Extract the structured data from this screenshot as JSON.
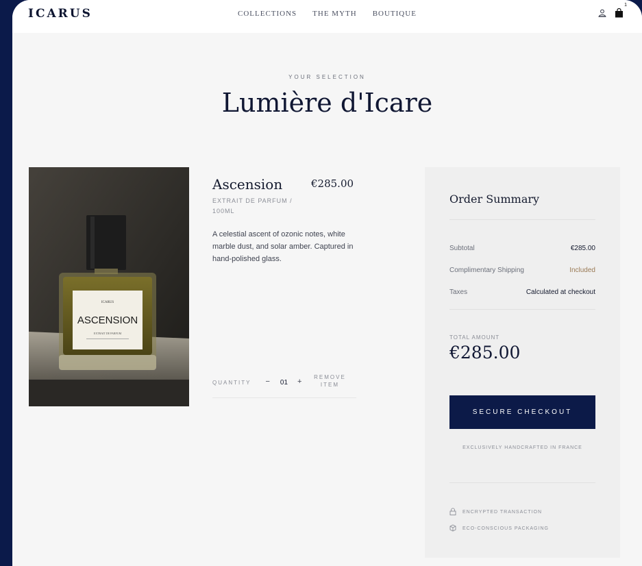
{
  "header": {
    "brand": "ICARUS",
    "nav": [
      {
        "label": "COLLECTIONS"
      },
      {
        "label": "THE MYTH"
      },
      {
        "label": "BOUTIQUE"
      }
    ],
    "icons": {
      "account": "user-icon",
      "cart": "shopping-bag-icon"
    },
    "cart_count": "1"
  },
  "hero": {
    "eyebrow": "YOUR SELECTION",
    "title": "Lumière d'Icare"
  },
  "product_image": {
    "label_brand": "ICARUS",
    "label_name": "ASCENSION",
    "label_sub": "EXTRAIT DE PARFUM"
  },
  "item": {
    "name": "Ascension",
    "price": "€285.00",
    "variant": "EXTRAIT DE PARFUM / 100ML",
    "description": "A celestial ascent of ozonic notes, white marble dust, and solar amber. Captured in hand-polished glass.",
    "quantity_label": "QUANTITY",
    "minus": "−",
    "quantity": "01",
    "plus": "+",
    "remove": "REMOVE ITEM"
  },
  "summary": {
    "title": "Order Summary",
    "rows": [
      {
        "label": "Subtotal",
        "value": "€285.00"
      },
      {
        "label": "Complimentary Shipping",
        "value": "Included"
      },
      {
        "label": "Taxes",
        "value": "Calculated at checkout"
      }
    ],
    "total_label": "TOTAL AMOUNT",
    "total_amount": "€285.00",
    "checkout_label": "SECURE CHECKOUT",
    "handcrafted": "EXCLUSIVELY HANDCRAFTED IN FRANCE",
    "trust": [
      {
        "icon": "lock-icon",
        "label": "ENCRYPTED TRANSACTION"
      },
      {
        "icon": "box-icon",
        "label": "ECO-CONSCIOUS PACKAGING"
      }
    ]
  },
  "colors": {
    "accent": "#0c1a48",
    "background": "#f6f6f6",
    "outer": "#0b1a4a",
    "included": "#9a7a55"
  }
}
